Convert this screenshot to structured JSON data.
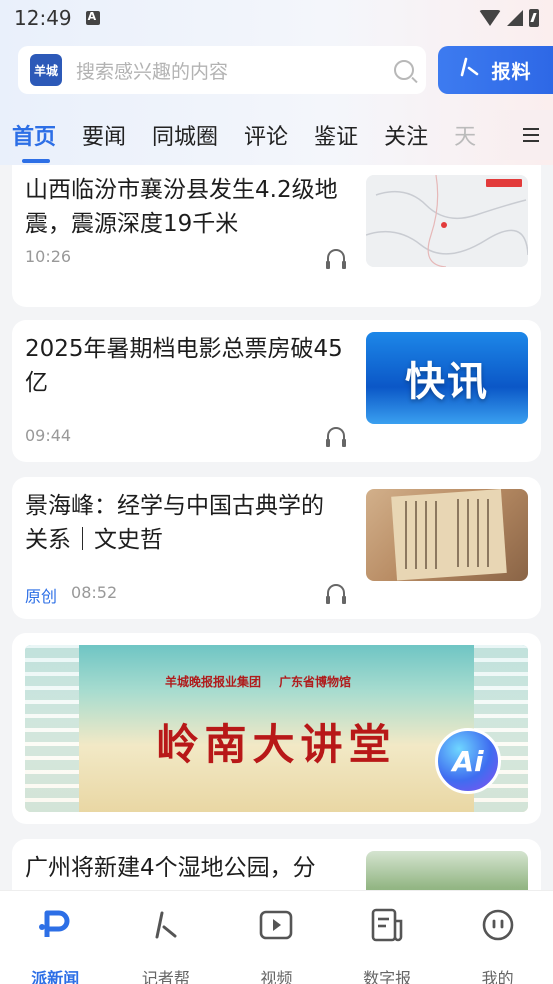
{
  "status": {
    "time": "12:49"
  },
  "search": {
    "placeholder": "搜索感兴趣的内容",
    "logo_text": "羊城"
  },
  "report_button": {
    "label": "报料",
    "icon": "reporter-pen-icon"
  },
  "tabs": [
    {
      "label": "首页",
      "active": true
    },
    {
      "label": "要闻"
    },
    {
      "label": "同城圈"
    },
    {
      "label": "评论"
    },
    {
      "label": "鉴证"
    },
    {
      "label": "关注"
    },
    {
      "label": "天"
    }
  ],
  "feed": [
    {
      "title": "山西临汾市襄汾县发生4.2级地震，震源深度19千米",
      "time": "10:26",
      "thumb": "earthquake-map"
    },
    {
      "title": "2025年暑期档电影总票房破45亿",
      "time": "09:44",
      "thumb": "flash-news",
      "thumb_text": "快讯"
    },
    {
      "title": "景海峰：经学与中国古典学的关系｜文史哲",
      "tag": "原创",
      "time": "08:52",
      "thumb": "ancient-book"
    },
    {
      "banner_title": "岭南大讲堂",
      "banner_logo_left": "羊城晚报报业集团",
      "banner_logo_right": "广东省博物馆",
      "ai_label": "Ai"
    },
    {
      "title": "广州将新建4个湿地公园，分",
      "thumb": "wetland-park"
    }
  ],
  "bottom_nav": [
    {
      "label": "派新闻",
      "icon": "pai-news-icon",
      "active": true
    },
    {
      "label": "记者帮",
      "icon": "reporter-help-icon"
    },
    {
      "label": "视频",
      "icon": "video-play-icon"
    },
    {
      "label": "数字报",
      "icon": "digital-paper-icon"
    },
    {
      "label": "我的",
      "icon": "profile-face-icon"
    }
  ],
  "colors": {
    "accent": "#2d6fe6",
    "banner_red": "#b81818"
  }
}
